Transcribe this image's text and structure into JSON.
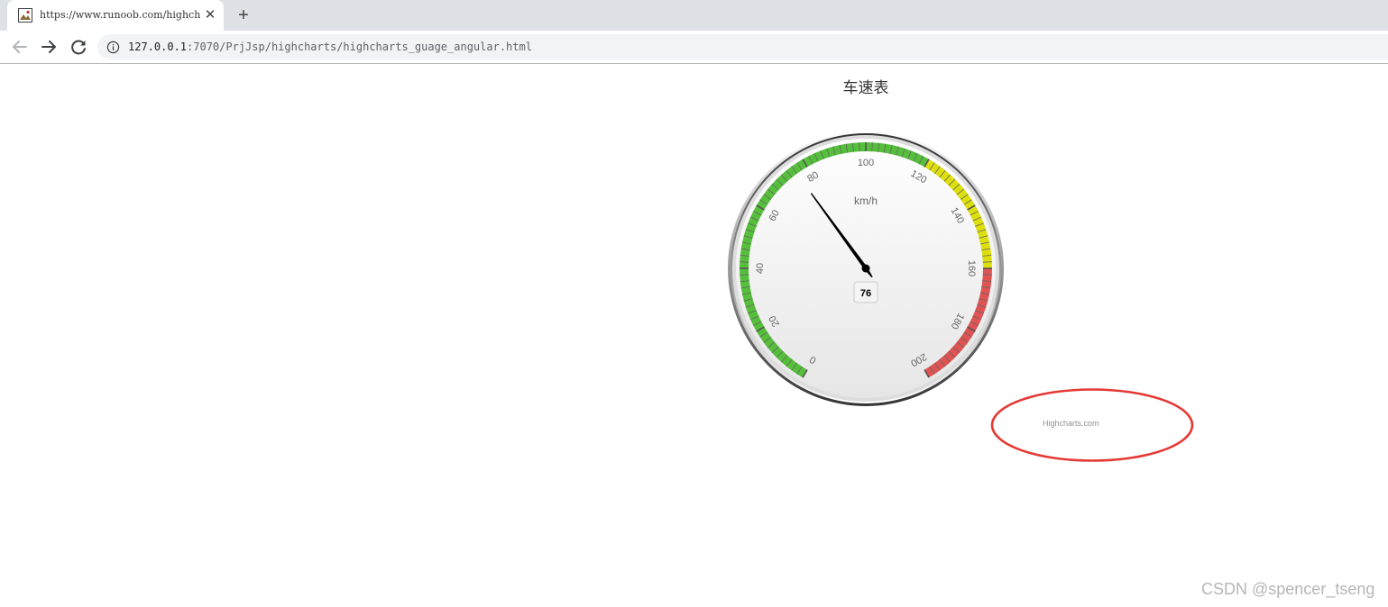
{
  "browser": {
    "tab": {
      "title": "https://www.runoob.com/highcharts",
      "favicon": "image-favicon-icon"
    },
    "new_tab_label": "+",
    "close_tab_label": "✕",
    "nav": {
      "back_icon": "arrow-left-icon",
      "forward_icon": "arrow-right-icon",
      "reload_icon": "reload-icon",
      "info_icon": "info-icon"
    },
    "url": {
      "host": "127.0.0.1",
      "path": ":7070/PrjJsp/highcharts/highcharts_guage_angular.html"
    }
  },
  "chart_data": {
    "type": "gauge",
    "title": "车速表",
    "unit": "km/h",
    "min": 0,
    "max": 200,
    "value": 76,
    "tick_labels": [
      "0",
      "20",
      "40",
      "60",
      "80",
      "100",
      "120",
      "140",
      "160",
      "180",
      "200"
    ],
    "bands": [
      {
        "from": 0,
        "to": 120,
        "color": "#55bf3b"
      },
      {
        "from": 120,
        "to": 160,
        "color": "#dddf0d"
      },
      {
        "from": 160,
        "to": 200,
        "color": "#df5353"
      }
    ],
    "credit": "Highcharts.com"
  },
  "watermark": "CSDN @spencer_tseng",
  "annotation": {
    "color": "#e53935"
  }
}
